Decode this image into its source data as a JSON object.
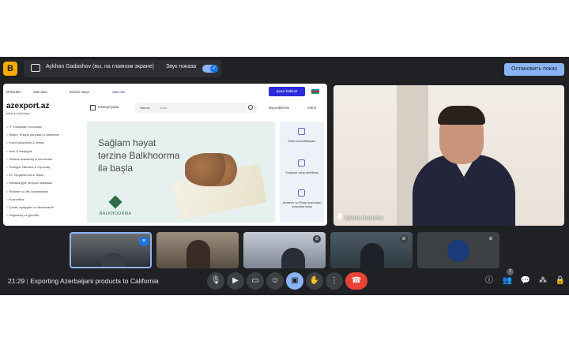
{
  "app": {
    "logo_letter": "B"
  },
  "presenting": {
    "text": "Aykhan Gadashov (вы, на главном экране)",
    "sound_label": "Звук показа",
    "stop_button": "Остановить показ"
  },
  "site": {
    "nav": [
      "Məhsullar",
      "Satıcılara",
      "Bizimlə əlaqə",
      "Satıcıları"
    ],
    "login_button": "Şəxsi kabinet",
    "logo": "azexport.az",
    "logo_sub": "Made in Azerbaijan",
    "categories_button": "Kateqoriyalar",
    "search_select": "Hamısı",
    "search_placeholder": "Axtar...",
    "favorites": "Bəyəndiklərim",
    "cart": "Səbət",
    "categories": [
      "İT məhsulları və kodları",
      "Maşın, Ehtiyat parçaları & Aksesuar",
      "Kənd təsərrüfatı & Ərzaq",
      "Avto & Nəqliyyat",
      "Elektrik avadanlıq & elementlər",
      "Hədiyyə, İstirahət & Oyuncaq",
      "Ev, İşıqlandırma & Tikinti",
      "Metallurgiya, kimyəvi maddələr",
      "Reklam və ofis ləvazimatları",
      "Kosmetika",
      "Çanta, ayaqqabı və aksesuarlar",
      "Sağlamlıq və gözəllik"
    ],
    "banner_lines": [
      "Sağlam həyat",
      "tərzinə Balkhoorma",
      "ilə başla"
    ],
    "brand": "BALKHOORMA",
    "panel": [
      "İxrac konsultasiyası",
      "Sorğunu satış sertifikatı",
      "Amazon və Ebay üzərindən ixracatda satış"
    ]
  },
  "speaker": {
    "name": "Aykhan Gadashov"
  },
  "meeting": {
    "time": "21:29",
    "title": "Exporting Azerbaijani products to California",
    "participants_count": "7"
  },
  "colors": {
    "meet_bg": "#202124",
    "accent": "#8ab4f8",
    "end_call": "#ea4335",
    "site_button": "#2b2bdc"
  },
  "icons": [
    "mic-icon",
    "camera-icon",
    "captions-icon",
    "emoji-icon",
    "present-icon",
    "hand-icon",
    "more-icon",
    "end-call-icon",
    "info-icon",
    "people-icon",
    "chat-icon",
    "activities-icon",
    "lock-icon"
  ]
}
